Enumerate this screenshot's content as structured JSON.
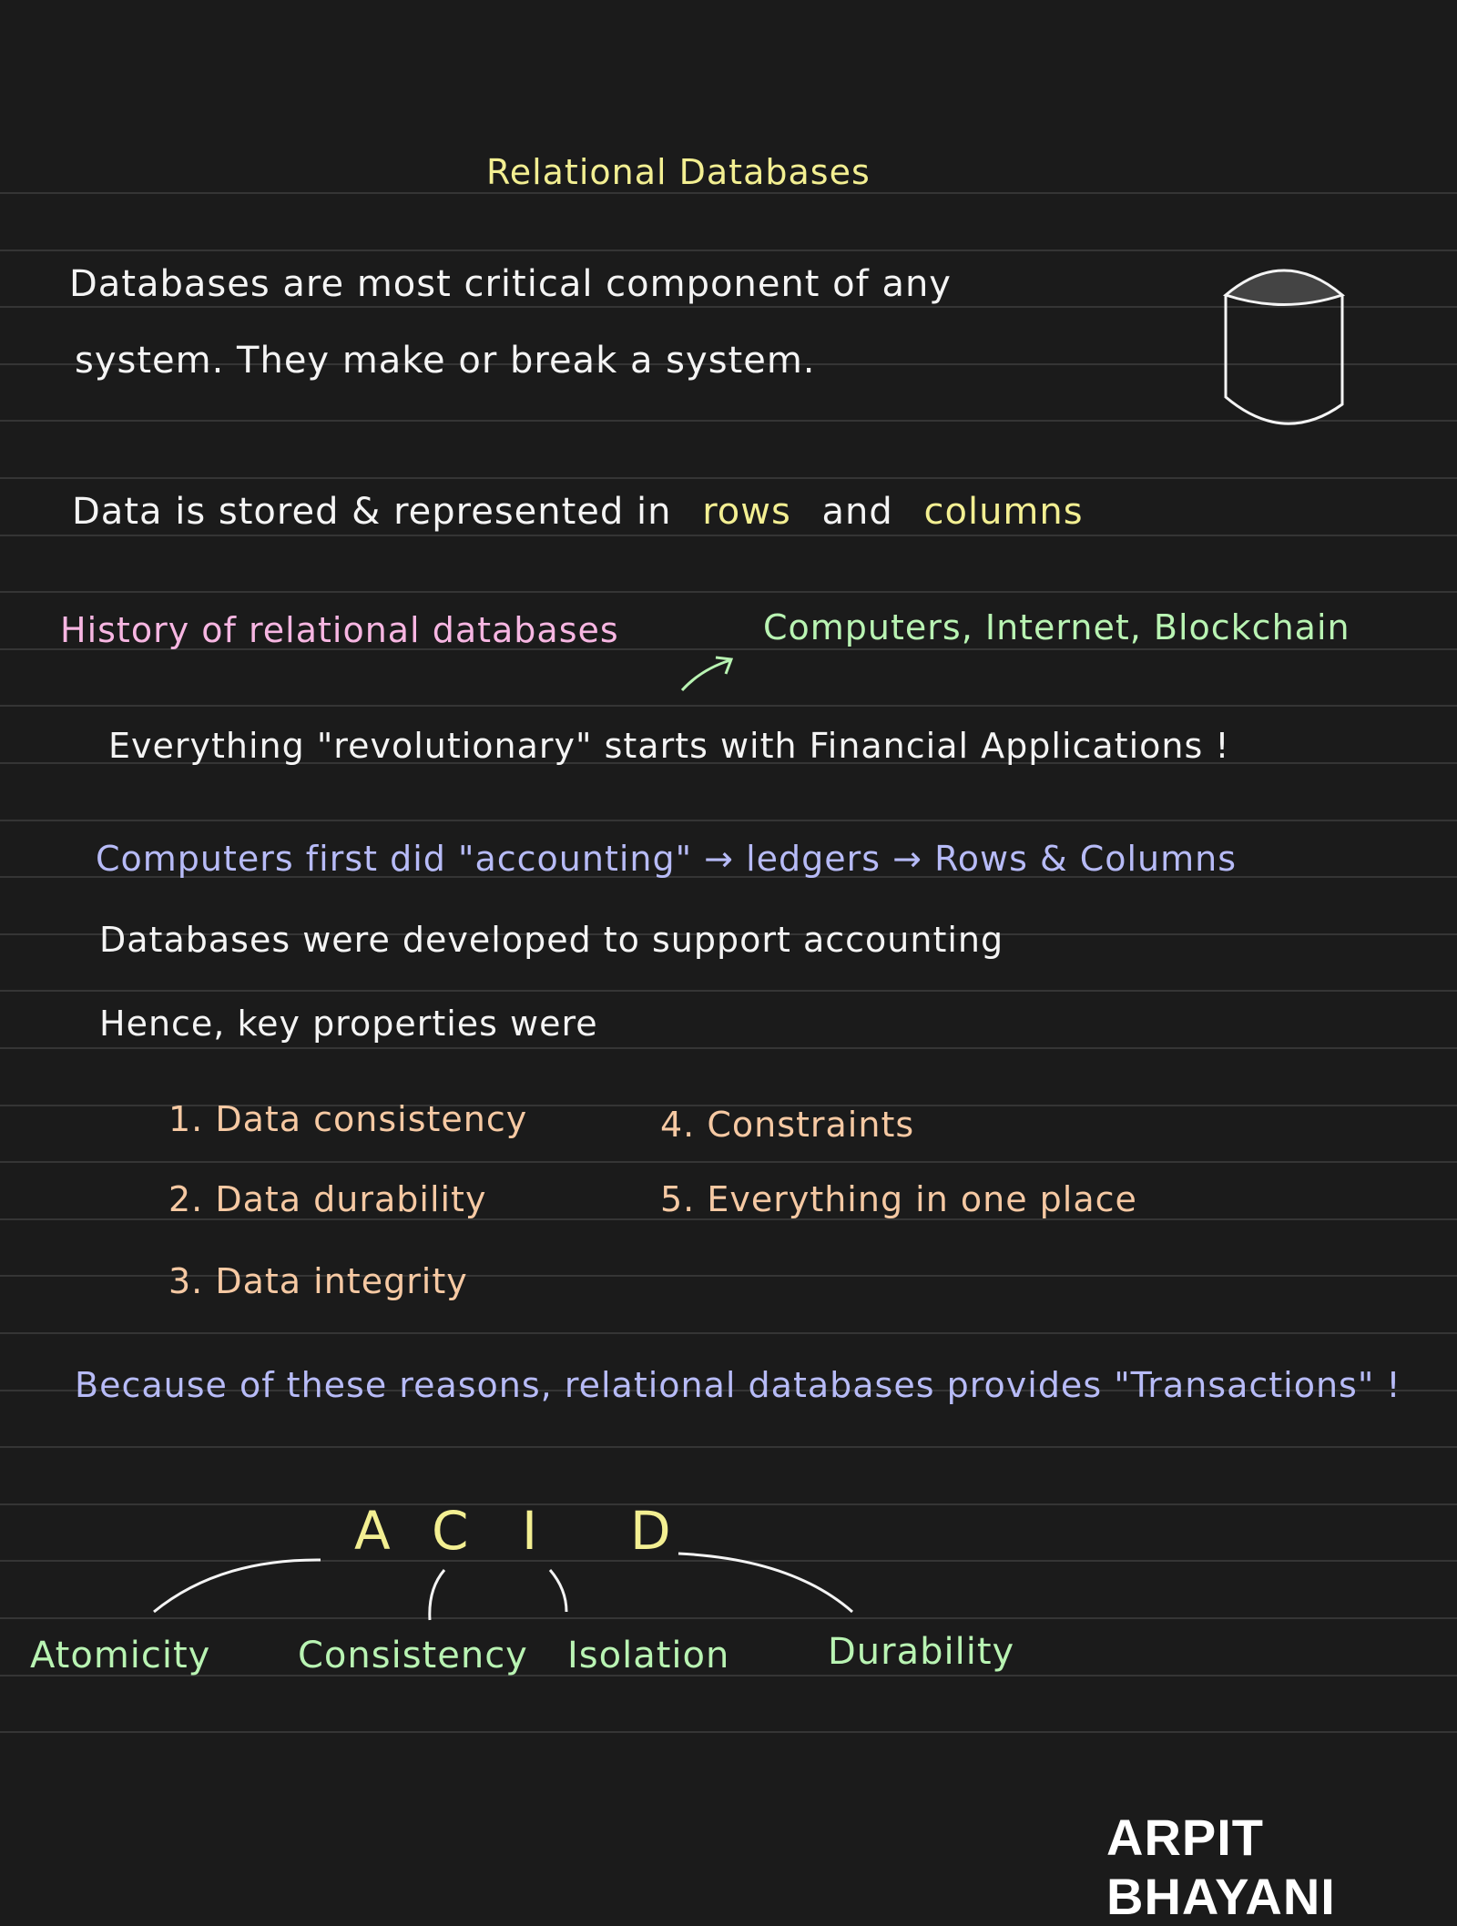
{
  "title": "Relational Databases",
  "intro": {
    "line1": "Databases are most critical component of any",
    "line2": "system. They make or break a system."
  },
  "storage": {
    "prefix": "Data is stored & represented in",
    "rows": "rows",
    "and": "and",
    "columns": "columns"
  },
  "history": {
    "heading": "History of relational databases",
    "examples": "Computers, Internet, Blockchain",
    "statement": "Everything \"revolutionary\" starts with Financial Applications !",
    "chain": "Computers first did \"accounting\" → ledgers → Rows & Columns",
    "developed": "Databases were developed to support accounting",
    "hence": "Hence, key properties were"
  },
  "properties": [
    "1. Data consistency",
    "2. Data durability",
    "3. Data integrity",
    "4. Constraints",
    "5. Everything in one place"
  ],
  "because": "Because of these reasons, relational databases provides \"Transactions\" !",
  "acid": {
    "letters": [
      "A",
      "C",
      "I",
      "D"
    ],
    "terms": [
      "Atomicity",
      "Consistency",
      "Isolation",
      "Durability"
    ]
  },
  "logo": "ARPIT BHAYANI",
  "colors": {
    "background": "#1b1b1b",
    "title": "#f3ef92",
    "heading": "#f7b6e2",
    "green": "#b9f4b3",
    "purple": "#b7bbf7",
    "orange": "#f6c9a3"
  },
  "icons": [
    "database-cylinder-icon",
    "arrow-icon"
  ]
}
